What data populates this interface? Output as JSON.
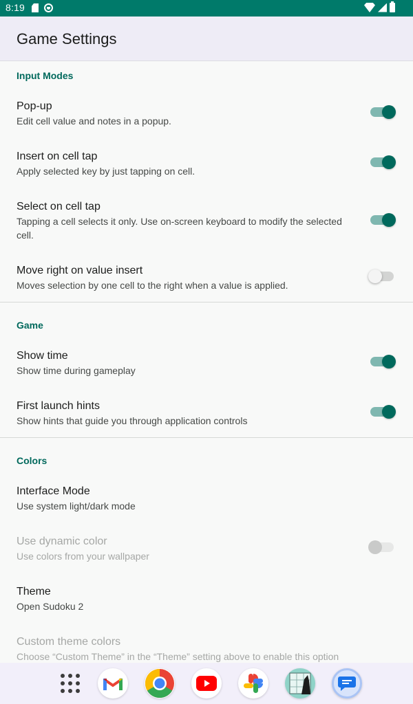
{
  "status_bar": {
    "time": "8:19",
    "icons": [
      "sd-card-icon",
      "sync-circle-icon",
      "wifi-icon",
      "signal-icon",
      "battery-icon"
    ]
  },
  "app_bar": {
    "title": "Game Settings"
  },
  "sections": {
    "input_modes": {
      "header": "Input Modes"
    },
    "game": {
      "header": "Game"
    },
    "colors": {
      "header": "Colors"
    }
  },
  "prefs": {
    "popup": {
      "title": "Pop-up",
      "summary": "Edit cell value and notes in a popup.",
      "enabled": true
    },
    "insert_on_tap": {
      "title": "Insert on cell tap",
      "summary": "Apply selected key by just tapping on cell.",
      "enabled": true
    },
    "select_on_tap": {
      "title": "Select on cell tap",
      "summary": "Tapping a cell selects it only. Use on-screen keyboard to modify the selected cell.",
      "enabled": true
    },
    "move_right": {
      "title": "Move right on value insert",
      "summary": "Moves selection by one cell to the right when a value is applied.",
      "enabled": false
    },
    "show_time": {
      "title": "Show time",
      "summary": "Show time during gameplay",
      "enabled": true
    },
    "first_launch_hints": {
      "title": "First launch hints",
      "summary": "Show hints that guide you through application controls",
      "enabled": true
    },
    "interface_mode": {
      "title": "Interface Mode",
      "summary": "Use system light/dark mode"
    },
    "dynamic_color": {
      "title": "Use dynamic color",
      "summary": "Use colors from your wallpaper",
      "enabled": false,
      "disabled": true
    },
    "theme": {
      "title": "Theme",
      "summary": "Open Sudoku 2"
    },
    "custom_theme_colors": {
      "title": "Custom theme colors",
      "summary": "Choose “Custom Theme” in the “Theme” setting above to enable this option",
      "disabled": true
    }
  },
  "dock": {
    "apps": [
      "apps-grid-icon",
      "gmail-icon",
      "chrome-icon",
      "youtube-icon",
      "photos-icon",
      "sudoku-app-icon",
      "messages-icon"
    ]
  },
  "colors": {
    "accent": "#00695c",
    "status_bar": "#007a6a",
    "app_bar": "#eeecf6"
  }
}
